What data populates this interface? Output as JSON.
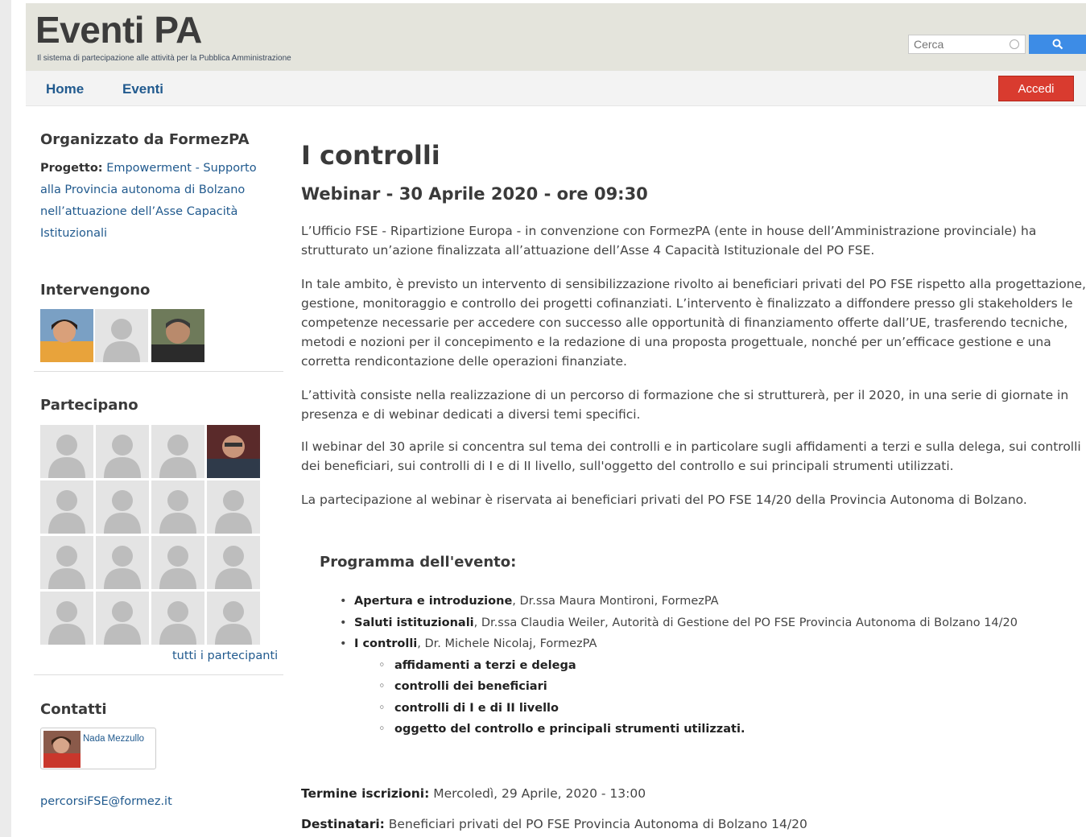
{
  "header": {
    "site_title": "Eventi PA",
    "tagline": "Il sistema di partecipazione alle attività per la Pubblica Amministrazione",
    "search_placeholder": "Cerca",
    "search_icon": "search-icon"
  },
  "nav": {
    "home": "Home",
    "eventi": "Eventi",
    "login": "Accedi"
  },
  "sidebar": {
    "organized_title": "Organizzato da FormezPA",
    "project_label": "Progetto:",
    "project_name": "Empowerment - Supporto alla Provincia autonoma di Bolzano nell’attuazione dell’Asse Capacità Istituzionali",
    "speakers_title": "Intervengono",
    "participants_title": "Partecipano",
    "all_participants": "tutti i partecipanti",
    "contacts_title": "Contatti",
    "contact_name": "Nada Mezzullo",
    "contact_email": "percorsiFSE@formez.it"
  },
  "main": {
    "title": "I controlli",
    "subtitle": "Webinar - 30 Aprile 2020 - ore 09:30",
    "p1": "L’Ufficio FSE - Ripartizione Europa - in convenzione con FormezPA (ente in house dell’Amministrazione provinciale) ha strutturato un’azione finalizzata all’attuazione dell’Asse 4 Capacità Istituzionale del PO FSE.",
    "p2": "In tale ambito, è previsto un intervento di sensibilizzazione rivolto ai beneficiari privati del PO FSE rispetto alla progettazione, gestione, monitoraggio e controllo dei progetti cofinanziati. L’intervento è finalizzato a diffondere presso gli stakeholders le competenze necessarie per accedere con successo alle opportunità di finanziamento offerte dall’UE, trasferendo tecniche, metodi e nozioni per il concepimento e la redazione di una proposta progettuale, nonché per un’efficace gestione e una corretta rendicontazione delle operazioni finanziate.",
    "p3": "L’attività consiste nella realizzazione di un percorso di formazione che si strutturerà, per il 2020, in una serie di giornate in presenza e di webinar dedicati a diversi temi specifici.",
    "p4": "Il webinar del 30 aprile si concentra sul tema dei controlli e in particolare sugli affidamenti a terzi e sulla delega, sui controlli dei beneficiari, sui controlli di I e di II livello, sull'oggetto del controllo e sui principali strumenti utilizzati.",
    "p5": "La partecipazione al webinar è riservata ai beneficiari privati del PO FSE 14/20 della Provincia Autonoma di Bolzano.",
    "program_title": "Programma dell'evento:",
    "program": [
      {
        "bold": "Apertura e introduzione",
        "rest": ", Dr.ssa Maura Montironi, FormezPA"
      },
      {
        "bold": "Saluti istituzionali",
        "rest": ", Dr.ssa Claudia Weiler, Autorità di Gestione del PO FSE Provincia Autonoma di Bolzano 14/20"
      },
      {
        "bold": "I controlli",
        "rest": ", Dr. Michele Nicolaj, FormezPA"
      }
    ],
    "subprogram": [
      "affidamenti a terzi e delega",
      "controlli dei beneficiari",
      "controlli di I e di II livello",
      "oggetto del controllo e principali strumenti utilizzati."
    ],
    "deadline_label": "Termine iscrizioni:",
    "deadline_value": "Mercoledì, 29 Aprile, 2020 - 13:00",
    "recipients_label": "Destinatari:",
    "recipients_value": "Beneficiari privati del PO FSE Provincia Autonoma di Bolzano 14/20"
  }
}
